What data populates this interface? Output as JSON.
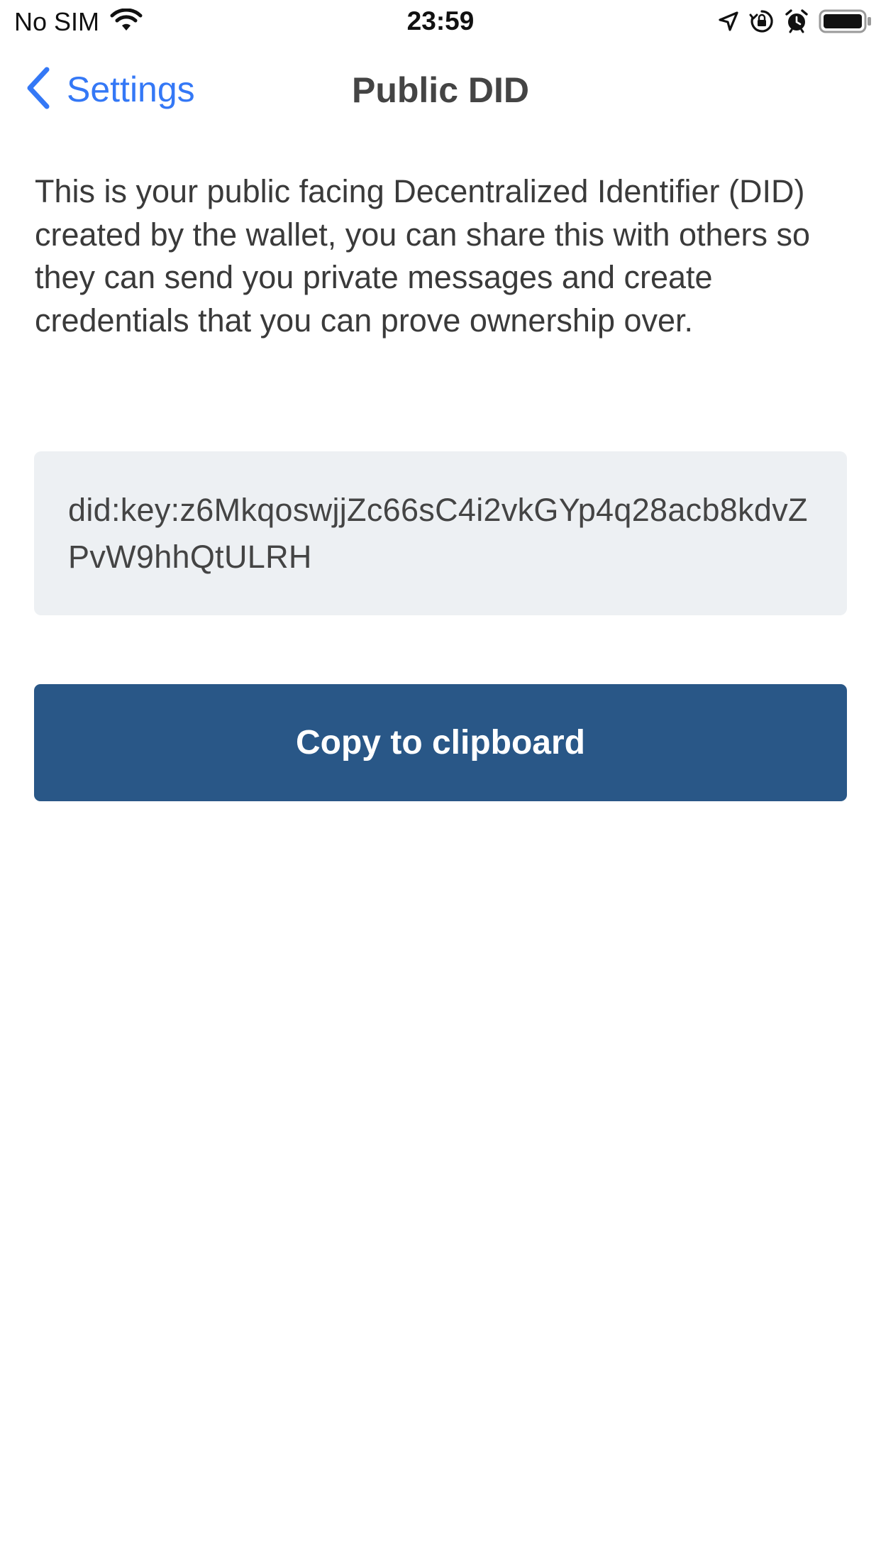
{
  "status_bar": {
    "carrier": "No SIM",
    "time": "23:59",
    "icons": [
      "wifi-icon",
      "location-arrow-icon",
      "orientation-lock-icon",
      "alarm-icon",
      "battery-icon"
    ]
  },
  "nav": {
    "back_label": "Settings",
    "title": "Public DID",
    "accent_color": "#3478f6"
  },
  "content": {
    "description": "This is your public facing Decentralized Identifier (DID) created by the wallet, you can share this with others so they can send you private messages and create credentials that you can prove ownership over.",
    "did": "did:key:z6MkqoswjjZc66sC4i2vkGYp4q28acb8kdvZPvW9hhQtULRH",
    "copy_button_label": "Copy to clipboard",
    "button_color": "#295787"
  }
}
